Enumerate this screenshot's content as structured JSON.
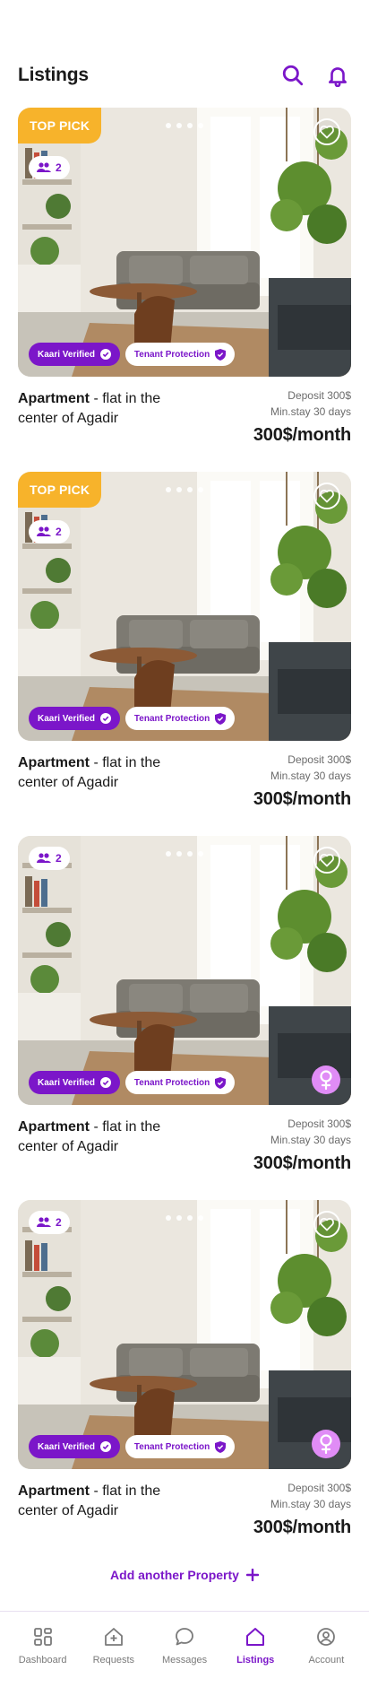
{
  "header": {
    "title": "Listings"
  },
  "listings": [
    {
      "top_pick": "TOP PICK",
      "guests": "2",
      "badge_verified": "Kaari Verified",
      "badge_protection": "Tenant Protection",
      "title_bold": "Apartment",
      "title_rest": " - flat in the center of Agadir",
      "deposit": "Deposit 300$",
      "min_stay": "Min.stay 30 days",
      "price": "300$/month",
      "female_only": false
    },
    {
      "top_pick": "TOP PICK",
      "guests": "2",
      "badge_verified": "Kaari Verified",
      "badge_protection": "Tenant Protection",
      "title_bold": "Apartment",
      "title_rest": " - flat in the center of Agadir",
      "deposit": "Deposit 300$",
      "min_stay": "Min.stay 30 days",
      "price": "300$/month",
      "female_only": false
    },
    {
      "top_pick": "",
      "guests": "2",
      "badge_verified": "Kaari Verified",
      "badge_protection": "Tenant Protection",
      "title_bold": "Apartment",
      "title_rest": " - flat in the center of Agadir",
      "deposit": "Deposit 300$",
      "min_stay": "Min.stay 30 days",
      "price": "300$/month",
      "female_only": true
    },
    {
      "top_pick": "",
      "guests": "2",
      "badge_verified": "Kaari Verified",
      "badge_protection": "Tenant Protection",
      "title_bold": "Apartment",
      "title_rest": " - flat in the center of Agadir",
      "deposit": "Deposit 300$",
      "min_stay": "Min.stay 30 days",
      "price": "300$/month",
      "female_only": true
    }
  ],
  "add_property": {
    "label": "Add another Property"
  },
  "tabbar": {
    "items": [
      {
        "label": "Dashboard",
        "icon": "dashboard-icon"
      },
      {
        "label": "Requests",
        "icon": "requests-icon"
      },
      {
        "label": "Messages",
        "icon": "messages-icon"
      },
      {
        "label": "Listings",
        "icon": "listings-icon"
      },
      {
        "label": "Account",
        "icon": "account-icon"
      }
    ],
    "active": "Listings"
  },
  "colors": {
    "accent": "#7b16c9",
    "top_pick": "#f7b32b",
    "female": "#e08cf6"
  }
}
